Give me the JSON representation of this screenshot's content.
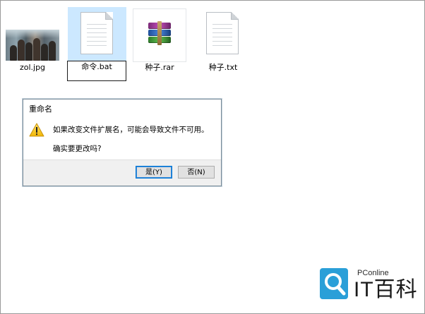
{
  "files": [
    {
      "name": "zol.jpg",
      "type": "image"
    },
    {
      "name": "命令.bat",
      "type": "document",
      "state": "renaming"
    },
    {
      "name": "种子.rar",
      "type": "archive"
    },
    {
      "name": "种子.txt",
      "type": "document"
    }
  ],
  "dialog": {
    "title": "重命名",
    "icon": "warning-icon",
    "message": "如果改变文件扩展名，可能会导致文件不可用。",
    "question": "确实要更改吗?",
    "yes_label": "是(Y)",
    "no_label": "否(N)"
  },
  "watermark": {
    "brand_small": "PConline",
    "brand_main": "IT百科",
    "icon": "magnifier-logo-icon",
    "color": "#2a9fd8"
  },
  "colors": {
    "selection": "#cce8ff",
    "button_focus_border": "#0078d7",
    "dialog_footer": "#f0f0f0"
  }
}
